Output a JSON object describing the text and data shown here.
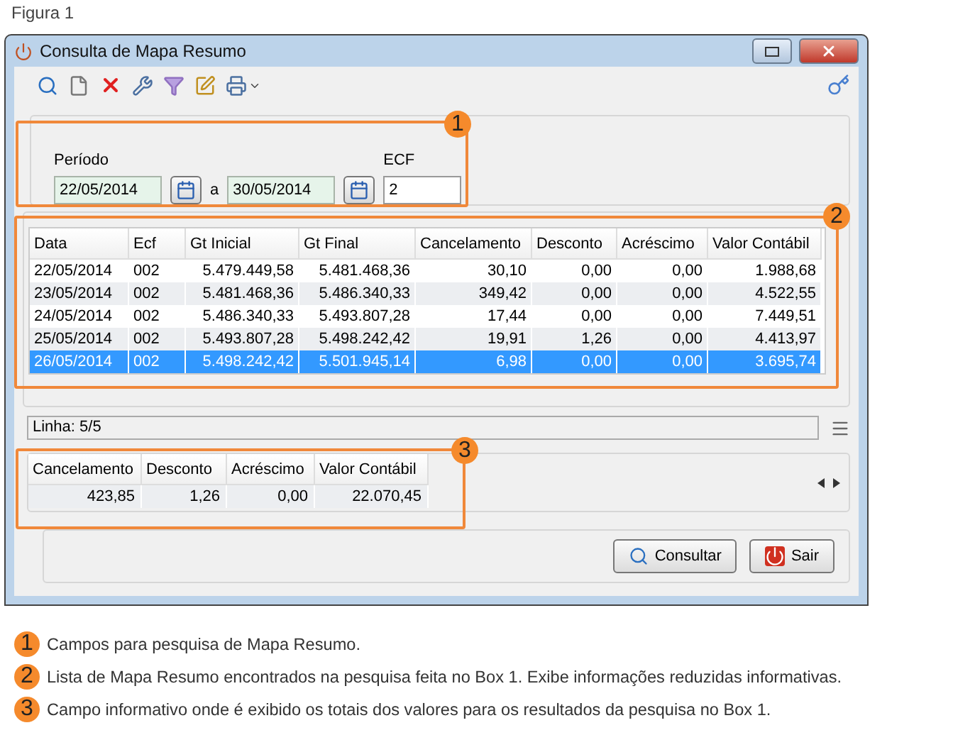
{
  "caption": "Figura 1",
  "window": {
    "title": "Consulta de Mapa Resumo"
  },
  "filters": {
    "period_label": "Período",
    "from": "22/05/2014",
    "separator": "a",
    "to": "30/05/2014",
    "ecf_label": "ECF",
    "ecf_value": "2"
  },
  "table": {
    "columns": [
      "Data",
      "Ecf",
      "Gt Inicial",
      "Gt Final",
      "Cancelamento",
      "Desconto",
      "Acréscimo",
      "Valor Contábil"
    ],
    "rows": [
      {
        "cells": [
          "22/05/2014",
          "002",
          "5.479.449,58",
          "5.481.468,36",
          "30,10",
          "0,00",
          "0,00",
          "1.988,68"
        ],
        "selected": false
      },
      {
        "cells": [
          "23/05/2014",
          "002",
          "5.481.468,36",
          "5.486.340,33",
          "349,42",
          "0,00",
          "0,00",
          "4.522,55"
        ],
        "selected": false
      },
      {
        "cells": [
          "24/05/2014",
          "002",
          "5.486.340,33",
          "5.493.807,28",
          "17,44",
          "0,00",
          "0,00",
          "7.449,51"
        ],
        "selected": false
      },
      {
        "cells": [
          "25/05/2014",
          "002",
          "5.493.807,28",
          "5.498.242,42",
          "19,91",
          "1,26",
          "0,00",
          "4.413,97"
        ],
        "selected": false
      },
      {
        "cells": [
          "26/05/2014",
          "002",
          "5.498.242,42",
          "5.501.945,14",
          "6,98",
          "0,00",
          "0,00",
          "3.695,74"
        ],
        "selected": true
      }
    ]
  },
  "status": "Linha: 5/5",
  "totals": {
    "columns": [
      "Cancelamento",
      "Desconto",
      "Acréscimo",
      "Valor Contábil"
    ],
    "values": [
      "423,85",
      "1,26",
      "0,00",
      "22.070,45"
    ]
  },
  "buttons": [
    {
      "label": "Consultar",
      "kind": "search"
    },
    {
      "label": "Sair",
      "kind": "exit"
    }
  ],
  "callouts": [
    "1",
    "2",
    "3"
  ],
  "legend": [
    {
      "number": "1",
      "text": "Campos para pesquisa de Mapa Resumo."
    },
    {
      "number": "2",
      "text": "Lista de Mapa Resumo encontrados na pesquisa feita no Box 1. Exibe informações reduzidas informativas."
    },
    {
      "number": "3",
      "text": "Campo informativo onde é exibido os totais dos valores para os resultados da pesquisa no Box 1."
    }
  ]
}
